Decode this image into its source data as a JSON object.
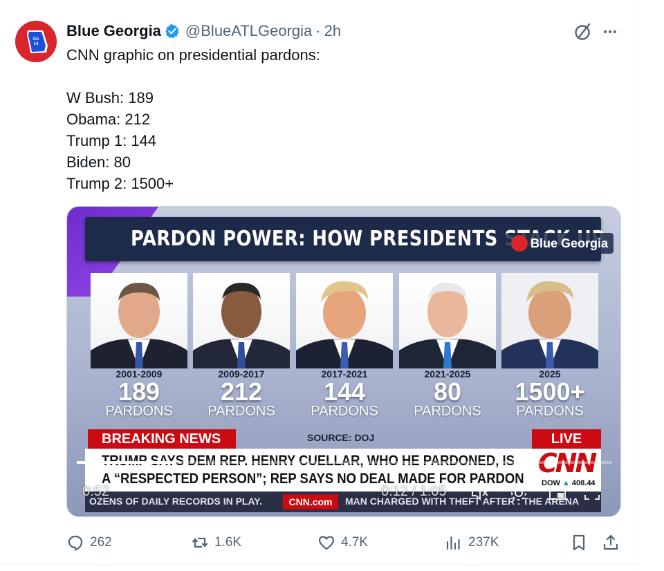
{
  "author": {
    "display_name": "Blue Georgia",
    "handle": "@BlueATLGeorgia",
    "time": "2h",
    "avatar_text": "GA 14"
  },
  "tweet": {
    "lines": [
      "CNN graphic on presidential pardons:",
      "",
      "W Bush: 189",
      "Obama: 212",
      "Trump 1: 144",
      "Biden: 80",
      "Trump 2: 1500+"
    ]
  },
  "video": {
    "headline": "PARDON POWER: HOW PRESIDENTS STACK UP",
    "watermark": "Blue Georgia",
    "presidents": [
      {
        "years": "2001-2009",
        "count": "189",
        "label": "PARDONS"
      },
      {
        "years": "2009-2017",
        "count": "212",
        "label": "PARDONS"
      },
      {
        "years": "2017-2021",
        "count": "144",
        "label": "PARDONS"
      },
      {
        "years": "2021-2025",
        "count": "80",
        "label": "PARDONS"
      },
      {
        "years": "2025",
        "count": "1500+",
        "label": "PARDONS"
      }
    ],
    "breaking_label": "BREAKING NEWS",
    "source": "SOURCE: DOJ",
    "live_label": "LIVE",
    "chyron_line1": "TRUMP SAYS DEM REP. HENRY CUELLAR, WHO HE PARDONED, IS",
    "chyron_line2": "A “RESPECTED PERSON”; REP SAYS NO DEAL MADE FOR PARDON",
    "network_logo": "CNN",
    "dow_label": "DOW",
    "dow_value": "408.44",
    "ticker_left": "OZENS OF DAILY RECORDS IN PLAY.",
    "ticker_site": "CNN.com",
    "ticker_right": "MAN CHARGED WITH THEFT AFTER . THE ARENA",
    "elapsed": "0:52",
    "timer": "0:12 / 1:05",
    "progress": 0.185
  },
  "actions": {
    "replies": "262",
    "reposts": "1.6K",
    "likes": "4.7K",
    "views": "237K"
  },
  "colors": {
    "accent": "#1d9bf0",
    "muted": "#536471",
    "cnn_red": "#cc0a12"
  }
}
